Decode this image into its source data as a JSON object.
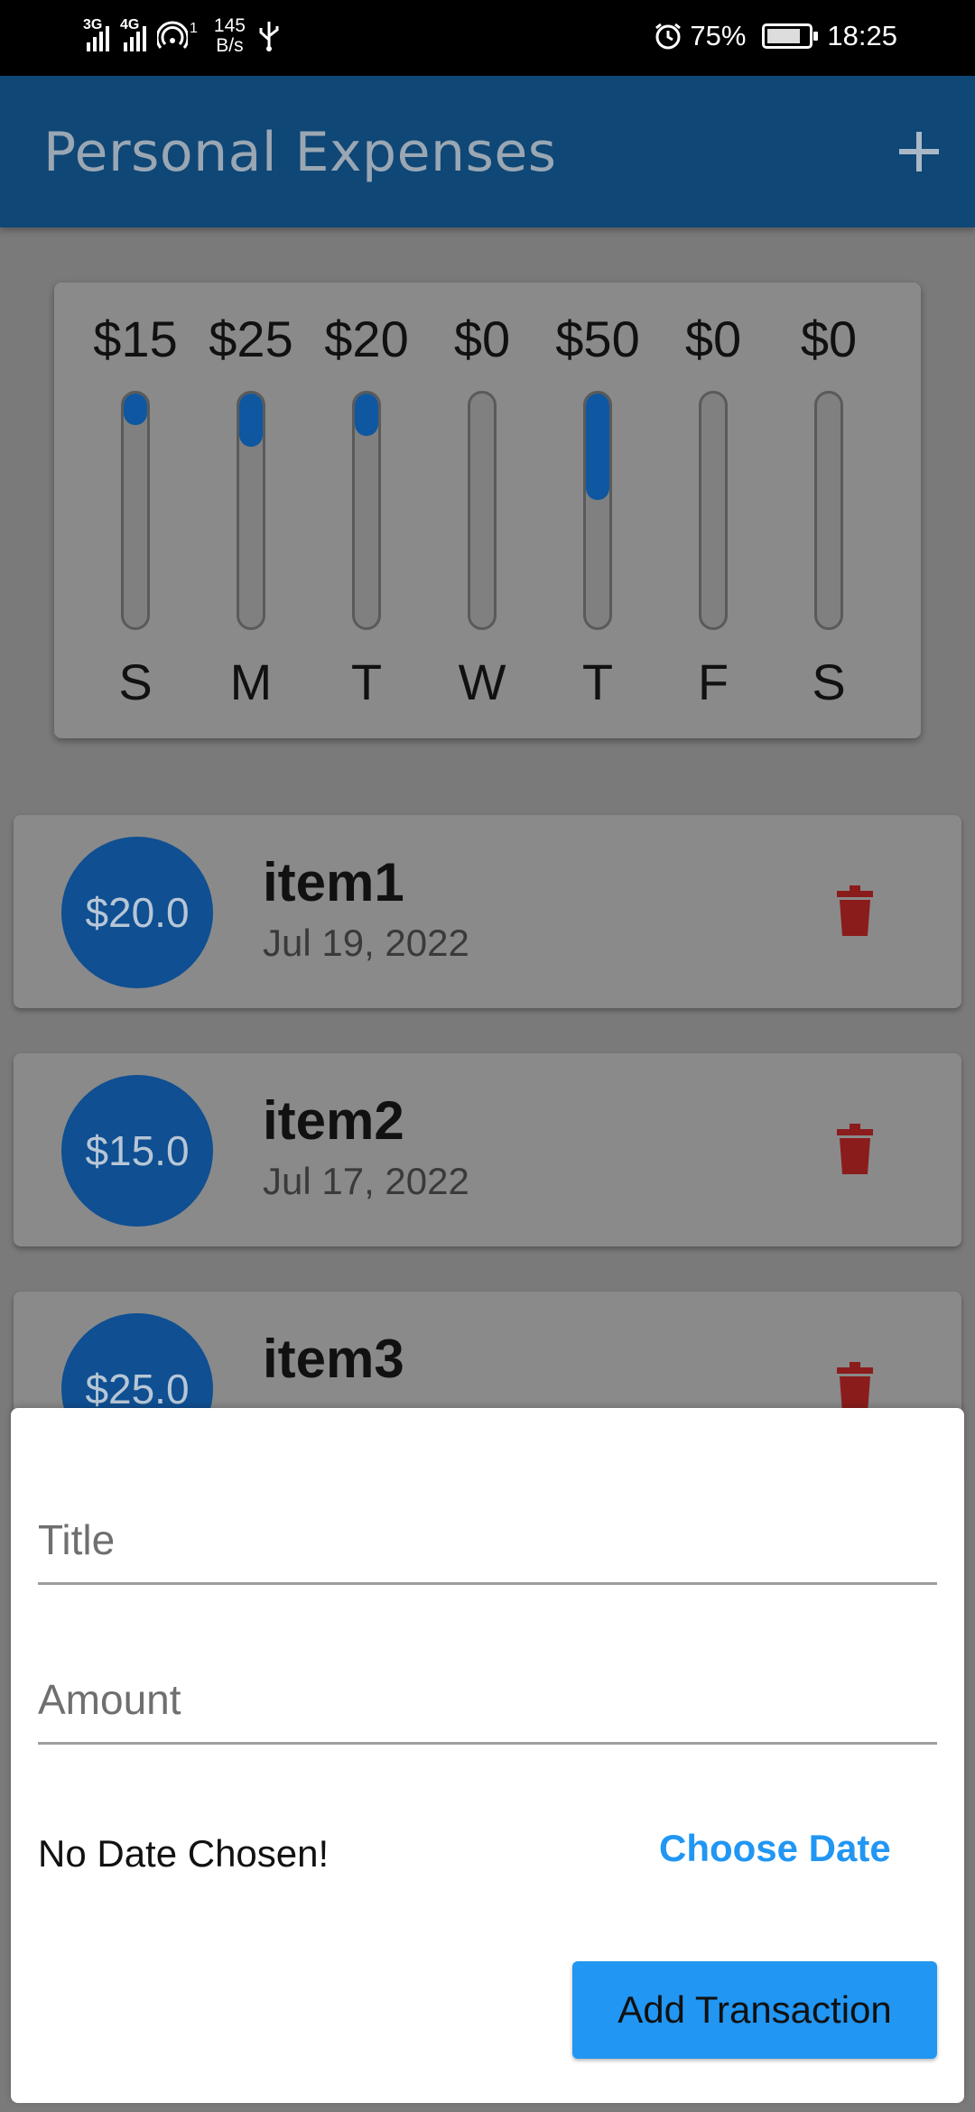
{
  "status_bar": {
    "network_1": "3G",
    "network_2": "4G",
    "hotspot_count": "1",
    "speed_value": "145",
    "speed_unit": "B/s",
    "battery": "75%",
    "time": "18:25"
  },
  "app_bar": {
    "title": "Personal Expenses",
    "add_icon": "plus-icon"
  },
  "colors": {
    "primary": "#0f4776",
    "bar_fill": "#0f57a0",
    "accent": "#2196f3",
    "delete": "#8b1c1c"
  },
  "chart_data": {
    "type": "bar",
    "categories": [
      "S",
      "M",
      "T",
      "W",
      "T",
      "F",
      "S"
    ],
    "labels": [
      "$15",
      "$25",
      "$20",
      "$0",
      "$50",
      "$0",
      "$0"
    ],
    "values": [
      15,
      25,
      20,
      0,
      50,
      0,
      0
    ],
    "ylim": [
      0,
      110
    ]
  },
  "transactions": [
    {
      "amount": "$20.0",
      "title": "item1",
      "date": "Jul 19, 2022"
    },
    {
      "amount": "$15.0",
      "title": "item2",
      "date": "Jul 17, 2022"
    },
    {
      "amount": "$25.0",
      "title": "item3",
      "date": ""
    }
  ],
  "form": {
    "title_placeholder": "Title",
    "amount_placeholder": "Amount",
    "date_status": "No Date Chosen!",
    "choose_date_label": "Choose Date",
    "submit_label": "Add Transaction"
  }
}
